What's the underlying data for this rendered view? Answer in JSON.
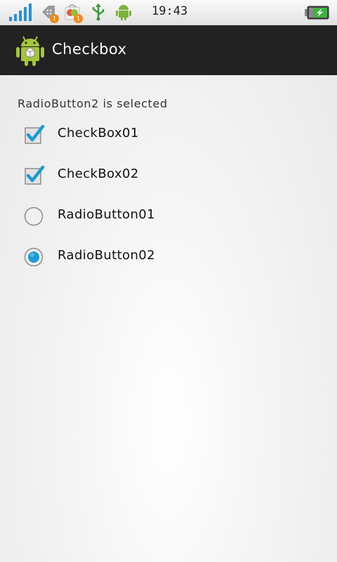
{
  "status_bar": {
    "time": "19:43",
    "icons": [
      "signal-icon",
      "notification-icon",
      "market-icon",
      "usb-icon",
      "android-debug-icon",
      "battery-charging-icon"
    ],
    "badge_1": "1",
    "badge_2": "1"
  },
  "action_bar": {
    "title": "Checkbox",
    "icon": "android-app-icon"
  },
  "main": {
    "status_text": "RadioButton2 is selected",
    "checkboxes": [
      {
        "label": "CheckBox01",
        "checked": true
      },
      {
        "label": "CheckBox02",
        "checked": true
      }
    ],
    "radios": [
      {
        "label": "RadioButton01",
        "selected": false
      },
      {
        "label": "RadioButton02",
        "selected": true
      }
    ]
  },
  "colors": {
    "accent": "#1a9ad6",
    "action_bar_bg": "#222222"
  }
}
